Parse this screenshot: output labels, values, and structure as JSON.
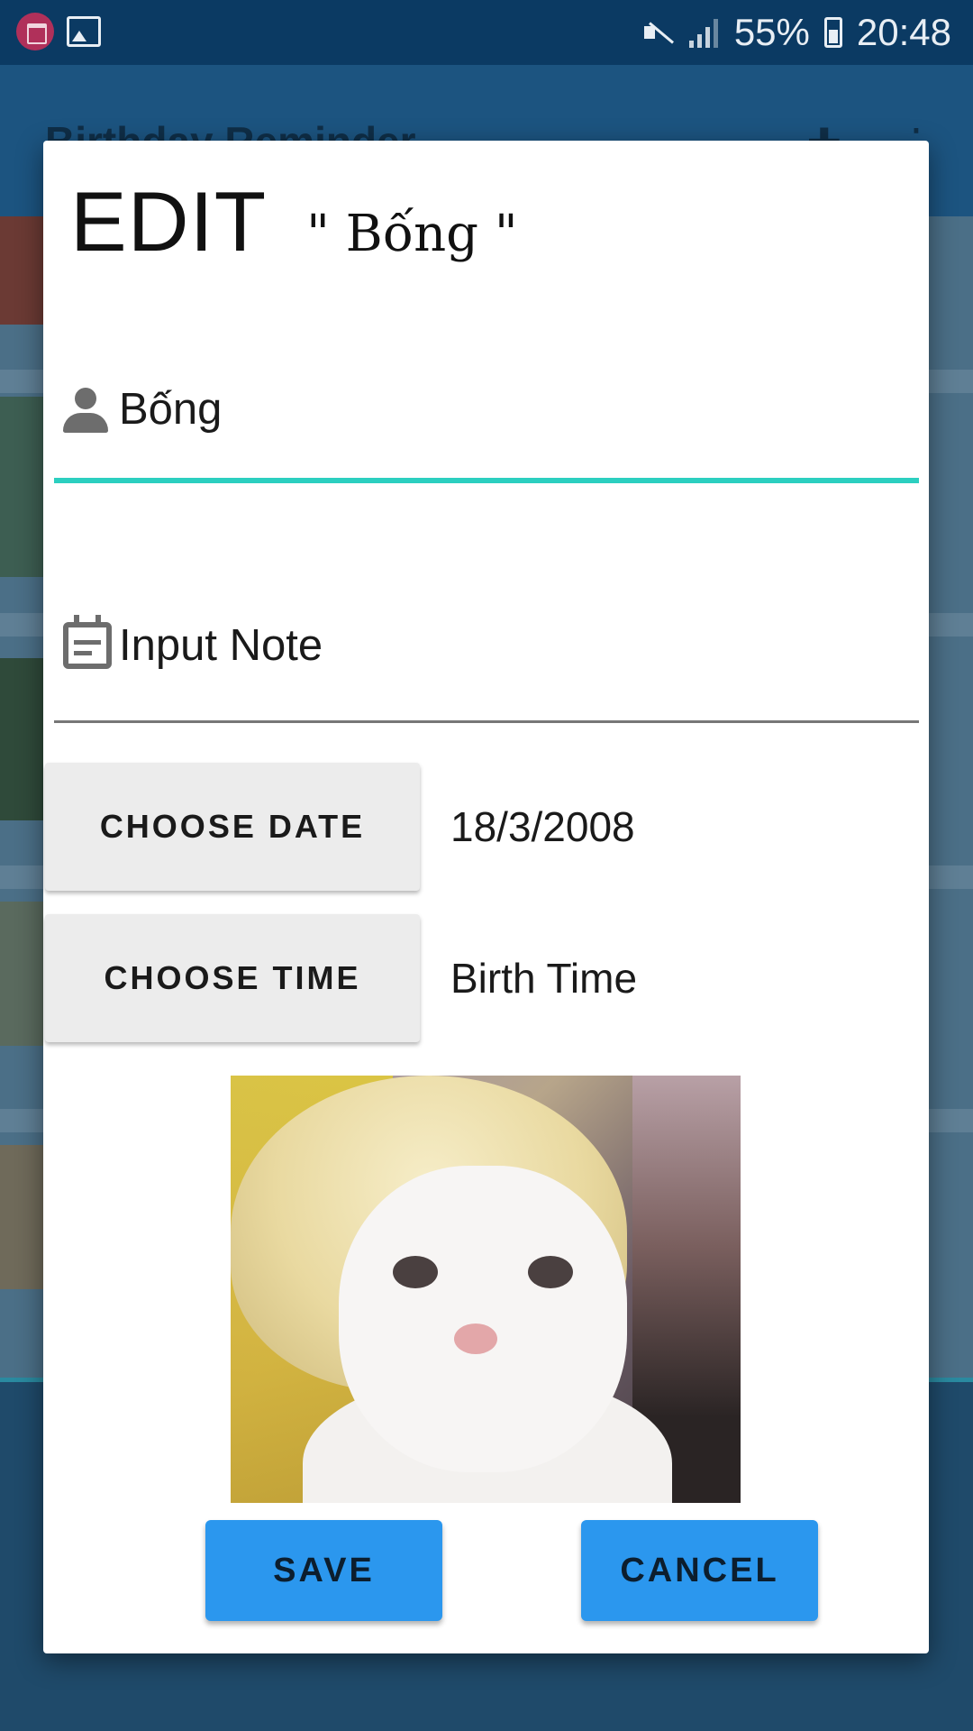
{
  "status_bar": {
    "battery_percent": "55%",
    "time": "20:48",
    "icons": [
      "birthday-app-icon",
      "gallery-icon",
      "mute-icon",
      "signal-icon",
      "battery-icon"
    ]
  },
  "background_app": {
    "title": "Birthday Reminder",
    "actions": [
      "add-person-icon",
      "more-vert-icon"
    ]
  },
  "dialog": {
    "mode_label": "EDIT",
    "name_quoted": "\" Bống \"",
    "name_field": {
      "value": "Bống",
      "icon": "person-icon",
      "accent_color": "#2ccfc0"
    },
    "note_field": {
      "placeholder": "Input Note",
      "icon": "note-icon"
    },
    "date": {
      "button_label": "CHOOSE DATE",
      "value": "18/3/2008"
    },
    "time": {
      "button_label": "CHOOSE TIME",
      "value": "Birth Time"
    },
    "photo_alt": "cat-photo",
    "save_label": "SAVE",
    "cancel_label": "CANCEL",
    "button_color": "#2b97ee"
  }
}
